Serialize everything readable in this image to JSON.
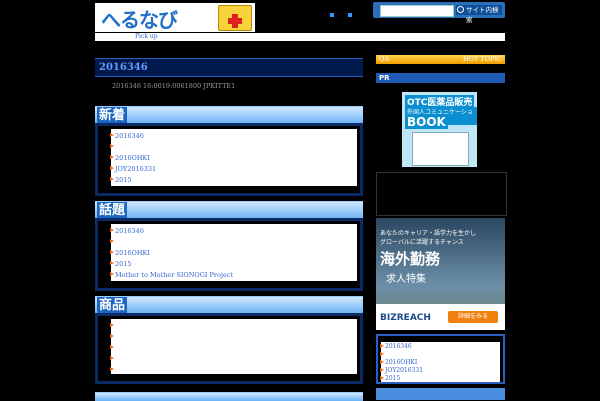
{
  "header": {
    "logo_text": "へるなび",
    "search_placeholder": "",
    "search_button_label": "サイト内検索"
  },
  "nav": {
    "pickup_label": "Pick up"
  },
  "main": {
    "title": "2016346",
    "meta": "2016346 16:0019:0061800 JPKITTE1"
  },
  "sections": [
    {
      "label": "新着",
      "items": [
        "2016346",
        "",
        "2016OHKI",
        "JOY2016331",
        "2015"
      ]
    },
    {
      "label": "話題",
      "items": [
        "2016346",
        "",
        "2016OHKI",
        "2015",
        "Mother to Mother SIONOGI Project"
      ]
    },
    {
      "label": "商品",
      "items": [
        "",
        "",
        "",
        "",
        ""
      ]
    }
  ],
  "sidebar": {
    "qa_label": "QA",
    "hot_topic_label": "HOT TOPIC",
    "pr_label": "PR",
    "book_ad": {
      "line1": "OTC医薬品販売",
      "line2": "外国人コミュニケーション",
      "line3": "BOOK"
    },
    "biz_ad": {
      "line1": "あなたのキャリア・語学力を生かし",
      "line2": "グローバルに活躍するチャンス",
      "headline": "海外勤務",
      "sub": "求人特集",
      "logo": "BIZREACH",
      "button": "詳細をみる"
    },
    "list": [
      "2016346",
      "",
      "2016OHKI",
      "JOY2016331",
      "2015"
    ]
  },
  "colors": {
    "accent": "#1f6fc4",
    "section_head": "#6ab2f5",
    "link": "#3366cc",
    "bullet": "#ff6600",
    "hot_bar": "#f39c00"
  }
}
